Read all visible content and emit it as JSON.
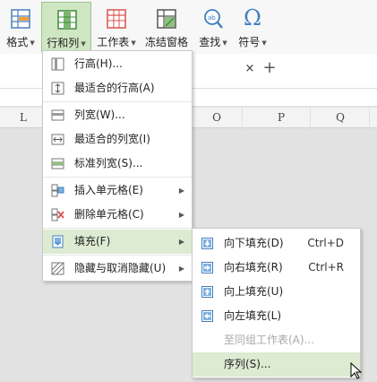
{
  "ribbon": {
    "format_label": "格式",
    "rowcol_label": "行和列",
    "worksheet_label": "工作表",
    "freeze_label": "冻结窗格",
    "find_label": "查找",
    "symbol_label": "符号",
    "symbol_glyph": "Ω",
    "caret": "▼"
  },
  "tabs": {
    "close_glyph": "×",
    "add_glyph": "+"
  },
  "columns": {
    "l": "L",
    "o": "O",
    "p": "P",
    "q": "Q"
  },
  "rowcol_menu": {
    "items": [
      {
        "label": "行高(H)...",
        "icon": "row-height-icon"
      },
      {
        "label": "最适合的行高(A)",
        "icon": "autofit-row-height-icon"
      },
      {
        "label": "列宽(W)...",
        "icon": "column-width-icon"
      },
      {
        "label": "最适合的列宽(I)",
        "icon": "autofit-column-width-icon"
      },
      {
        "label": "标准列宽(S)...",
        "icon": "standard-column-width-icon"
      },
      {
        "label": "插入单元格(E)",
        "icon": "insert-cells-icon"
      },
      {
        "label": "删除单元格(C)",
        "icon": "delete-cells-icon"
      },
      {
        "label": "填充(F)",
        "icon": "fill-icon"
      },
      {
        "label": "隐藏与取消隐藏(U)",
        "icon": "hide-unhide-icon"
      }
    ],
    "submenu_arrow": "▶"
  },
  "fill_menu": {
    "items": [
      {
        "label": "向下填充(D)",
        "shortcut": "Ctrl+D",
        "icon": "fill-down-icon"
      },
      {
        "label": "向右填充(R)",
        "shortcut": "Ctrl+R",
        "icon": "fill-right-icon"
      },
      {
        "label": "向上填充(U)",
        "shortcut": "",
        "icon": "fill-up-icon"
      },
      {
        "label": "向左填充(L)",
        "shortcut": "",
        "icon": "fill-left-icon"
      },
      {
        "label": "至同组工作表(A)...",
        "shortcut": "",
        "icon": ""
      },
      {
        "label": "序列(S)...",
        "shortcut": "",
        "icon": ""
      }
    ]
  },
  "colors": {
    "accent_green": "#cfe6c2",
    "highlight": "#dcebd2",
    "icon_blue": "#3f7fc1"
  }
}
